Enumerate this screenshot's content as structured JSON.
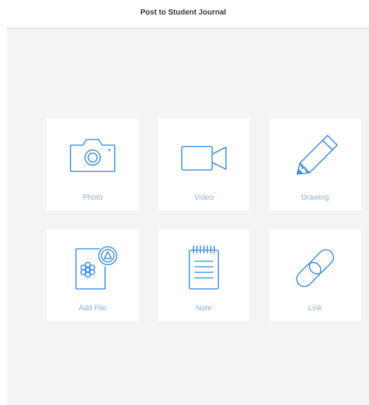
{
  "header": {
    "title": "Post to Student Journal"
  },
  "colors": {
    "accent": "#3d8ee3",
    "label": "#8fb1d9",
    "panel_bg": "#f4f4f4",
    "tile_bg": "#ffffff"
  },
  "tiles": [
    {
      "label": "Photo",
      "icon": "camera-icon"
    },
    {
      "label": "Video",
      "icon": "video-camera-icon"
    },
    {
      "label": "Drawing",
      "icon": "pencil-icon"
    },
    {
      "label": "Add File",
      "icon": "add-file-icon"
    },
    {
      "label": "Note",
      "icon": "notepad-icon"
    },
    {
      "label": "Link",
      "icon": "link-icon"
    }
  ]
}
